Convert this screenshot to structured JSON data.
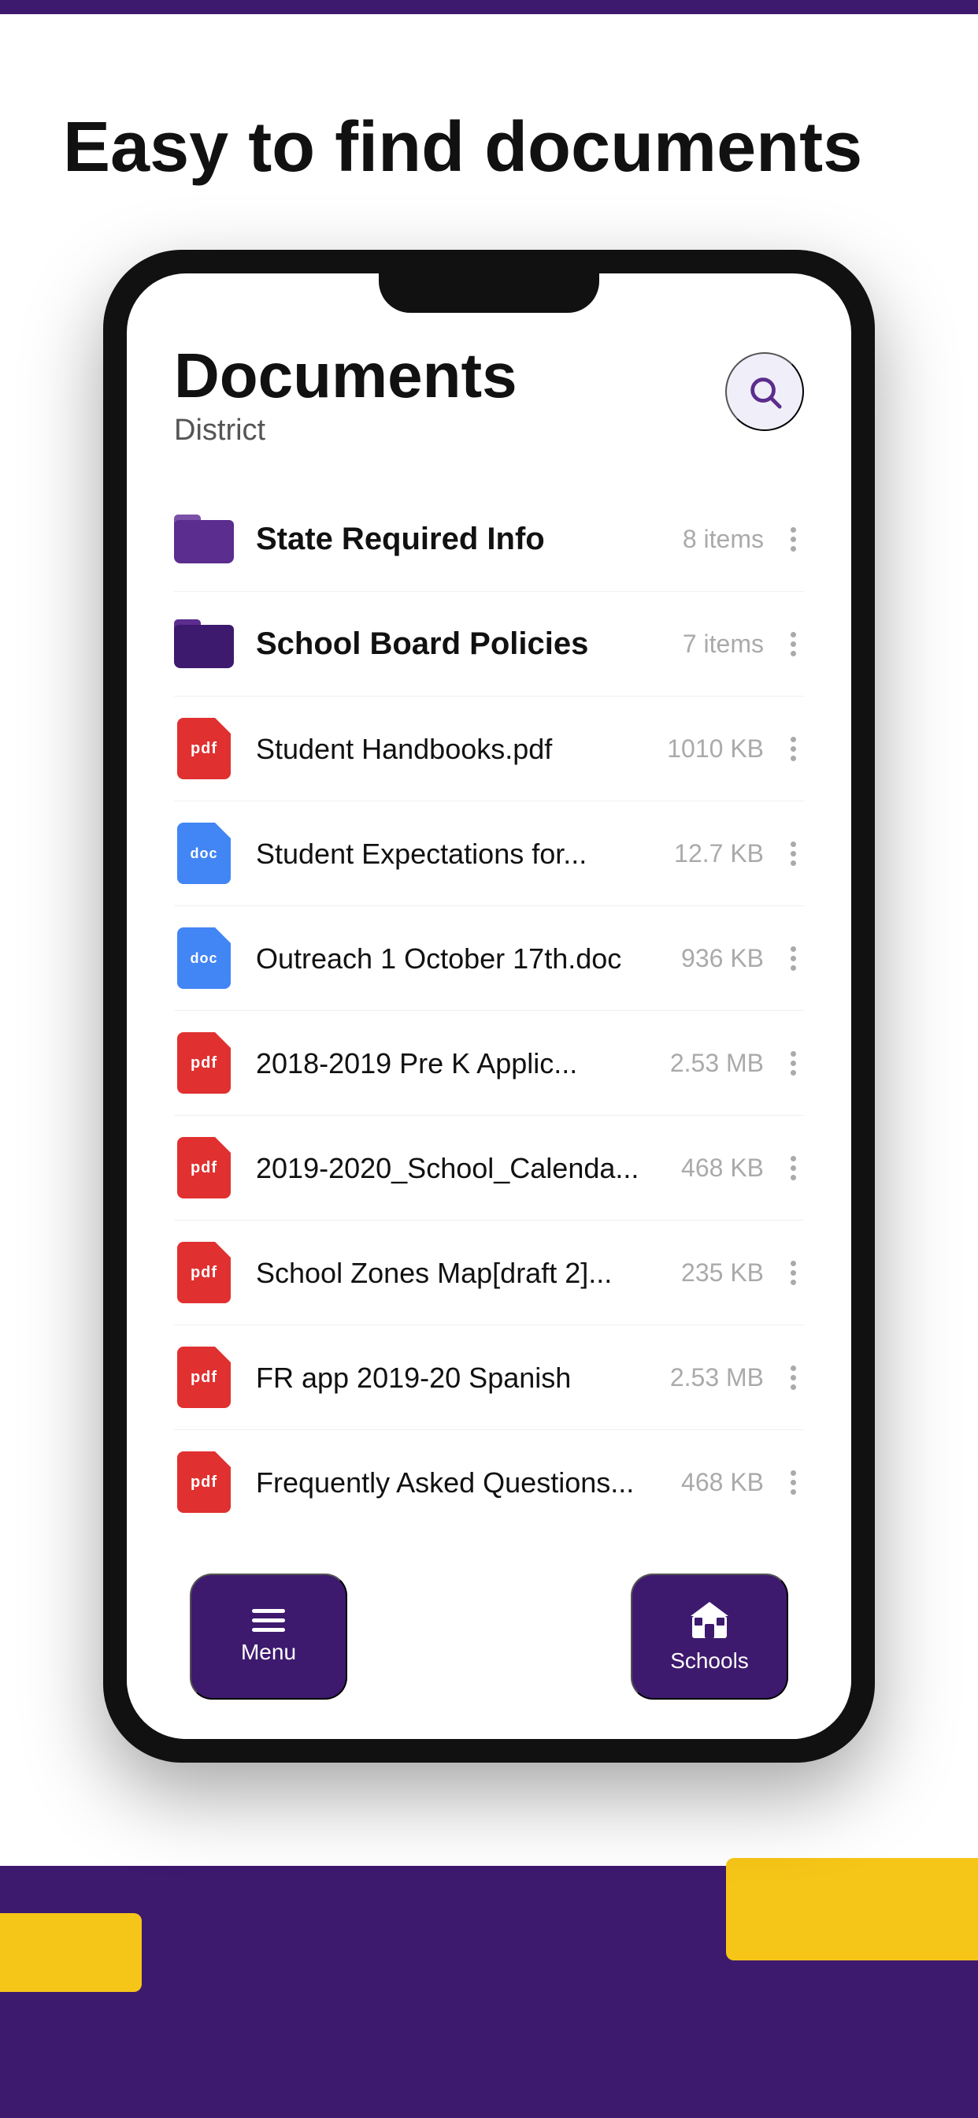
{
  "page": {
    "top_bar_color": "#3d1a6e",
    "hero_title": "Easy to find documents",
    "bottom_bg_color": "#3d1a6e",
    "yellow_accent_color": "#f5c518"
  },
  "screen": {
    "title": "Documents",
    "subtitle": "District",
    "search_aria": "Search"
  },
  "folders": [
    {
      "name": "State Required Info",
      "size": "8 items",
      "style": "purple"
    },
    {
      "name": "School Board Policies",
      "size": "7 items",
      "style": "purple2"
    }
  ],
  "files": [
    {
      "type": "pdf",
      "name": "Student Handbooks.pdf",
      "size": "1010 KB"
    },
    {
      "type": "doc",
      "name": "Student Expectations for...",
      "size": "12.7 KB"
    },
    {
      "type": "doc",
      "name": "Outreach 1 October 17th.doc",
      "size": "936 KB"
    },
    {
      "type": "pdf",
      "name": "2018-2019 Pre K Applic...",
      "size": "2.53 MB"
    },
    {
      "type": "pdf",
      "name": "2019-2020_School_Calenda...",
      "size": "468 KB"
    },
    {
      "type": "pdf",
      "name": "School Zones Map[draft 2]...",
      "size": "235 KB"
    },
    {
      "type": "pdf",
      "name": "FR app 2019-20 Spanish",
      "size": "2.53 MB"
    },
    {
      "type": "pdf",
      "name": "Frequently Asked Questions...",
      "size": "468 KB"
    }
  ],
  "nav": {
    "menu_label": "Menu",
    "schools_label": "Schools"
  }
}
